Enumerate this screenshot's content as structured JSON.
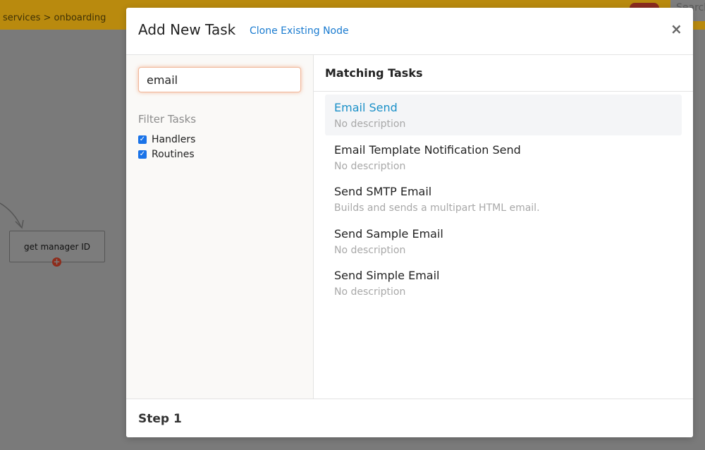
{
  "background": {
    "breadcrumb": "services > onboarding",
    "search_placeholder": "Search",
    "node_label": "get manager ID",
    "node_add_symbol": "+",
    "topbar_color": "#b98a0e"
  },
  "modal": {
    "title": "Add New Task",
    "clone_link": "Clone Existing Node",
    "close_symbol": "×",
    "search": {
      "value": "email"
    },
    "filter": {
      "title": "Filter Tasks",
      "options": [
        {
          "label": "Handlers",
          "checked": true
        },
        {
          "label": "Routines",
          "checked": true
        }
      ]
    },
    "matching": {
      "title": "Matching Tasks",
      "tasks": [
        {
          "name": "Email Send",
          "description": "No description",
          "selected": true
        },
        {
          "name": "Email Template Notification Send",
          "description": "No description",
          "selected": false
        },
        {
          "name": "Send SMTP Email",
          "description": "Builds and sends a multipart HTML email.",
          "selected": false
        },
        {
          "name": "Send Sample Email",
          "description": "No description",
          "selected": false
        },
        {
          "name": "Send Simple Email",
          "description": "No description",
          "selected": false
        }
      ]
    },
    "footer": {
      "step": "Step 1"
    },
    "accent_color": "#1a7bd0",
    "selected_color": "#1a90c8"
  }
}
